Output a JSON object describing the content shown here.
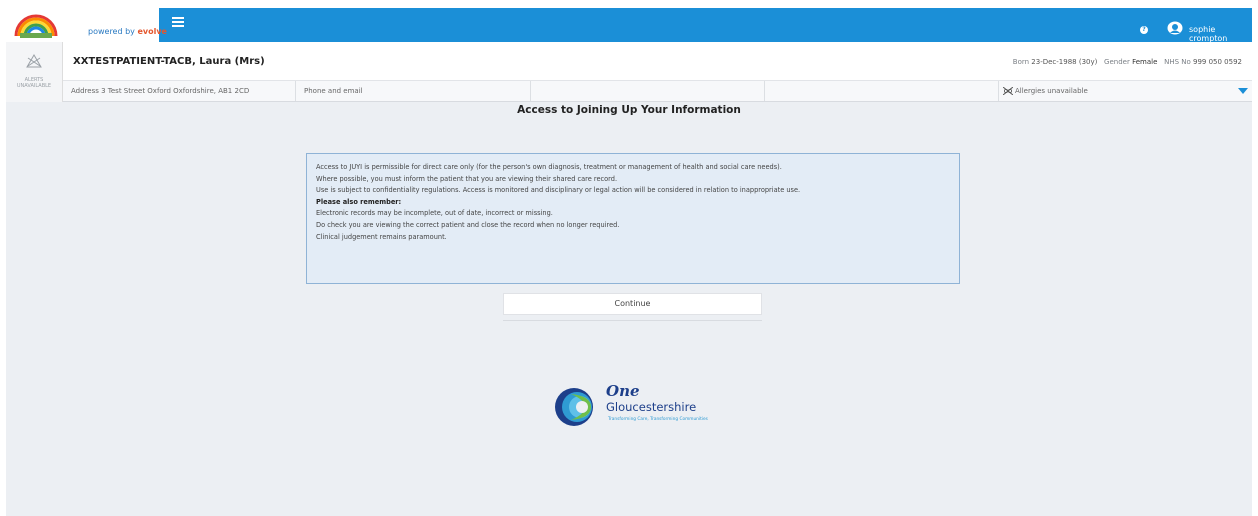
{
  "header": {
    "powered_by": "powered by",
    "powered_brand": "evolve",
    "user_name": "sophie crompton"
  },
  "alerts": {
    "label_line1": "ALERTS",
    "label_line2": "UNAVAILABLE"
  },
  "patient": {
    "name": "XXTESTPATIENT-TACB, Laura (Mrs)",
    "born_label": "Born",
    "born_value": "23-Dec-1988 (30y)",
    "gender_label": "Gender",
    "gender_value": "Female",
    "nhs_label": "NHS No",
    "nhs_value": "999 050 0592",
    "address": "Address 3 Test Street Oxford Oxfordshire, AB1 2CD",
    "phone_email": "Phone and email",
    "allergies": "Allergies unavailable"
  },
  "page": {
    "title": "Access to Joining Up Your Information",
    "notice_lines": [
      "Access to JUYI is permissible for direct care only (for the person's own diagnosis, treatment or management of health and social care needs).",
      "Where possible, you must inform the patient that you are viewing their shared care record.",
      "Use is subject to confidentiality regulations. Access is monitored and disciplinary or legal action will be considered in relation to inappropriate use.",
      "Please also remember:",
      "Electronic records may be incomplete, out of date, incorrect or missing.",
      "Do check you are viewing the correct patient and close the record when no longer required.",
      "Clinical judgement remains paramount."
    ],
    "continue_label": "Continue"
  },
  "branding": {
    "one": "One",
    "name": "Gloucestershire",
    "tagline": "Transforming Care, Transforming Communities"
  },
  "colors": {
    "topbar": "#1b8fd7",
    "brand_navy": "#1d3f8a",
    "brand_teal": "#2f9bd3",
    "notice_bg": "#e3ecf6",
    "notice_border": "#8fb3d6"
  }
}
